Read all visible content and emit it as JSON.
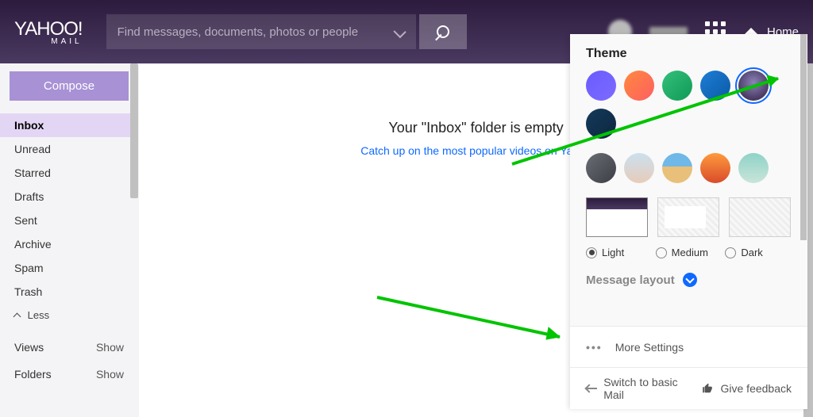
{
  "header": {
    "logo_main": "YAHOO!",
    "logo_sub": "MAIL",
    "search_placeholder": "Find messages, documents, photos or people",
    "home_label": "Home"
  },
  "sidebar": {
    "compose": "Compose",
    "folders": [
      {
        "label": "Inbox",
        "active": true
      },
      {
        "label": "Unread"
      },
      {
        "label": "Starred"
      },
      {
        "label": "Drafts"
      },
      {
        "label": "Sent"
      },
      {
        "label": "Archive"
      },
      {
        "label": "Spam"
      },
      {
        "label": "Trash"
      }
    ],
    "less": "Less",
    "sections": {
      "views": {
        "label": "Views",
        "action": "Show"
      },
      "folders": {
        "label": "Folders",
        "action": "Show"
      }
    }
  },
  "main": {
    "empty_title": "Your \"Inbox\" folder is empty",
    "empty_link": "Catch up on the most popular videos on Yahoo"
  },
  "settings": {
    "theme_header": "Theme",
    "swatches_row1": [
      {
        "name": "purple",
        "bg": "linear-gradient(135deg,#6a5bff,#7c6bff)"
      },
      {
        "name": "orange",
        "bg": "linear-gradient(135deg,#ff8a3d,#ff5e62)"
      },
      {
        "name": "green",
        "bg": "linear-gradient(135deg,#34c07a,#0f9b57)"
      },
      {
        "name": "blue",
        "bg": "linear-gradient(135deg,#1e7dd6,#0b5aa6)"
      },
      {
        "name": "plum",
        "bg": "radial-gradient(circle at 50% 40%,#8c83b9,#2d1b3e)",
        "selected": true
      },
      {
        "name": "navy",
        "bg": "linear-gradient(135deg,#153a5b,#0b2740)"
      }
    ],
    "swatches_row2": [
      {
        "name": "grey",
        "bg": "linear-gradient(135deg,#6a6d74,#3b3e45)"
      },
      {
        "name": "clouds",
        "bg": "linear-gradient(180deg,#cbe0ef,#e7ccba)"
      },
      {
        "name": "beach",
        "bg": "linear-gradient(180deg,#6fb8e8 45%,#e8c07a 45%)"
      },
      {
        "name": "sunset",
        "bg": "linear-gradient(180deg,#ff9a3c,#d94b2b)"
      },
      {
        "name": "mountain",
        "bg": "linear-gradient(180deg,#8fd2c8,#c9e5d8)"
      }
    ],
    "mode_options": [
      {
        "label": "Light",
        "selected": true
      },
      {
        "label": "Medium"
      },
      {
        "label": "Dark"
      }
    ],
    "message_layout": "Message layout",
    "more_settings": "More Settings",
    "switch_basic": "Switch to basic Mail",
    "give_feedback": "Give feedback"
  }
}
